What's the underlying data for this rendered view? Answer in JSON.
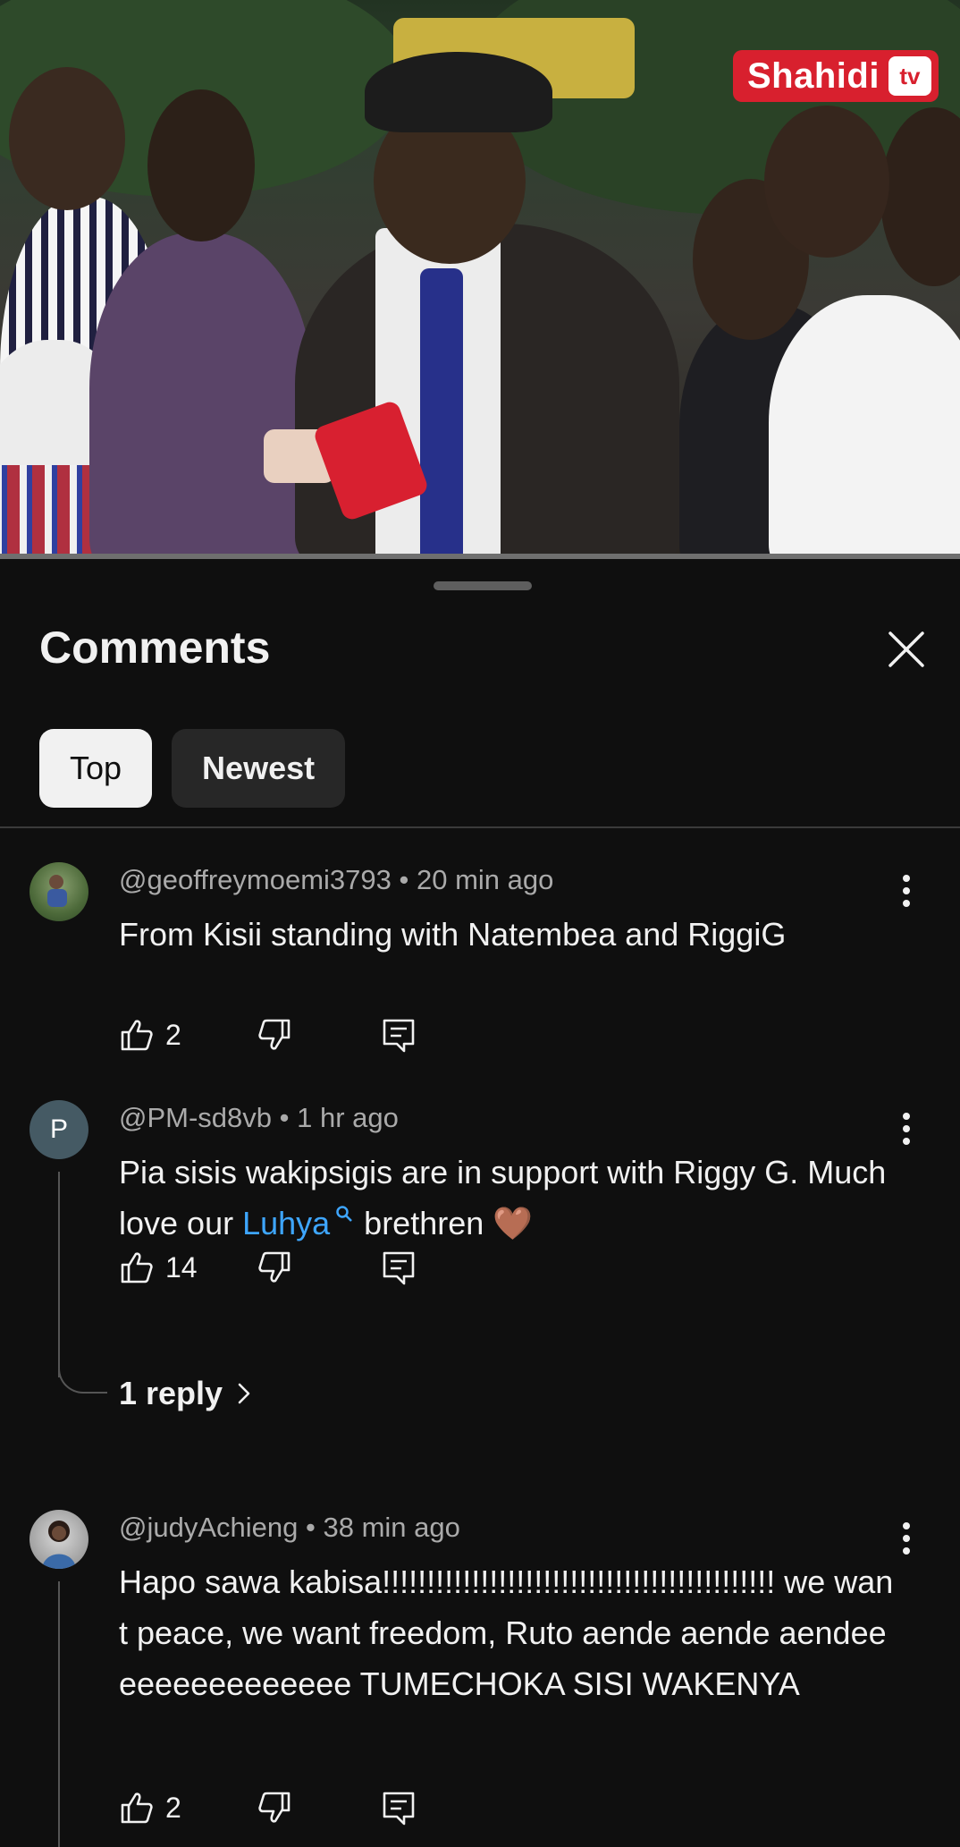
{
  "video": {
    "channel_logo_text": "Shahidi",
    "channel_logo_badge": "tv",
    "progress_fraction": 0.0
  },
  "comments_panel": {
    "title": "Comments",
    "close_icon": "close-icon",
    "filters": [
      {
        "label": "Top",
        "selected": true
      },
      {
        "label": "Newest",
        "selected": false
      }
    ],
    "items": [
      {
        "author": "@geoffreymoemi3793",
        "time": "20 min ago",
        "text": "From Kisii standing with Natembea and RiggiG",
        "likes": "2",
        "avatar_kind": "photo"
      },
      {
        "author": "@PM-sd8vb",
        "time": "1 hr ago",
        "text_parts": [
          "Pia sisis wakipsigis are in support with Riggy G. Much love our ",
          "Luhya",
          " brethren"
        ],
        "emoji": "🤎",
        "likes": "14",
        "avatar_letter": "P",
        "avatar_color": "#455a64",
        "replies_label": "1 reply"
      },
      {
        "author": "@judyAchieng",
        "time": "38 min ago",
        "text": "Hapo sawa kabisa!!!!!!!!!!!!!!!!!!!!!!!!!!!!!!!!!!!!!!!!!!!! we want peace, we want freedom, Ruto aende aende aendeeeeeeeeeeeeeee TUMECHOKA SISI WAKENYA",
        "likes": "2",
        "avatar_kind": "photo"
      }
    ],
    "icons": {
      "like": "thumbs-up-icon",
      "dislike": "thumbs-down-icon",
      "reply": "reply-icon",
      "more": "more-vert-icon",
      "search_link": "search-icon",
      "chevron": "chevron-right-icon"
    }
  }
}
